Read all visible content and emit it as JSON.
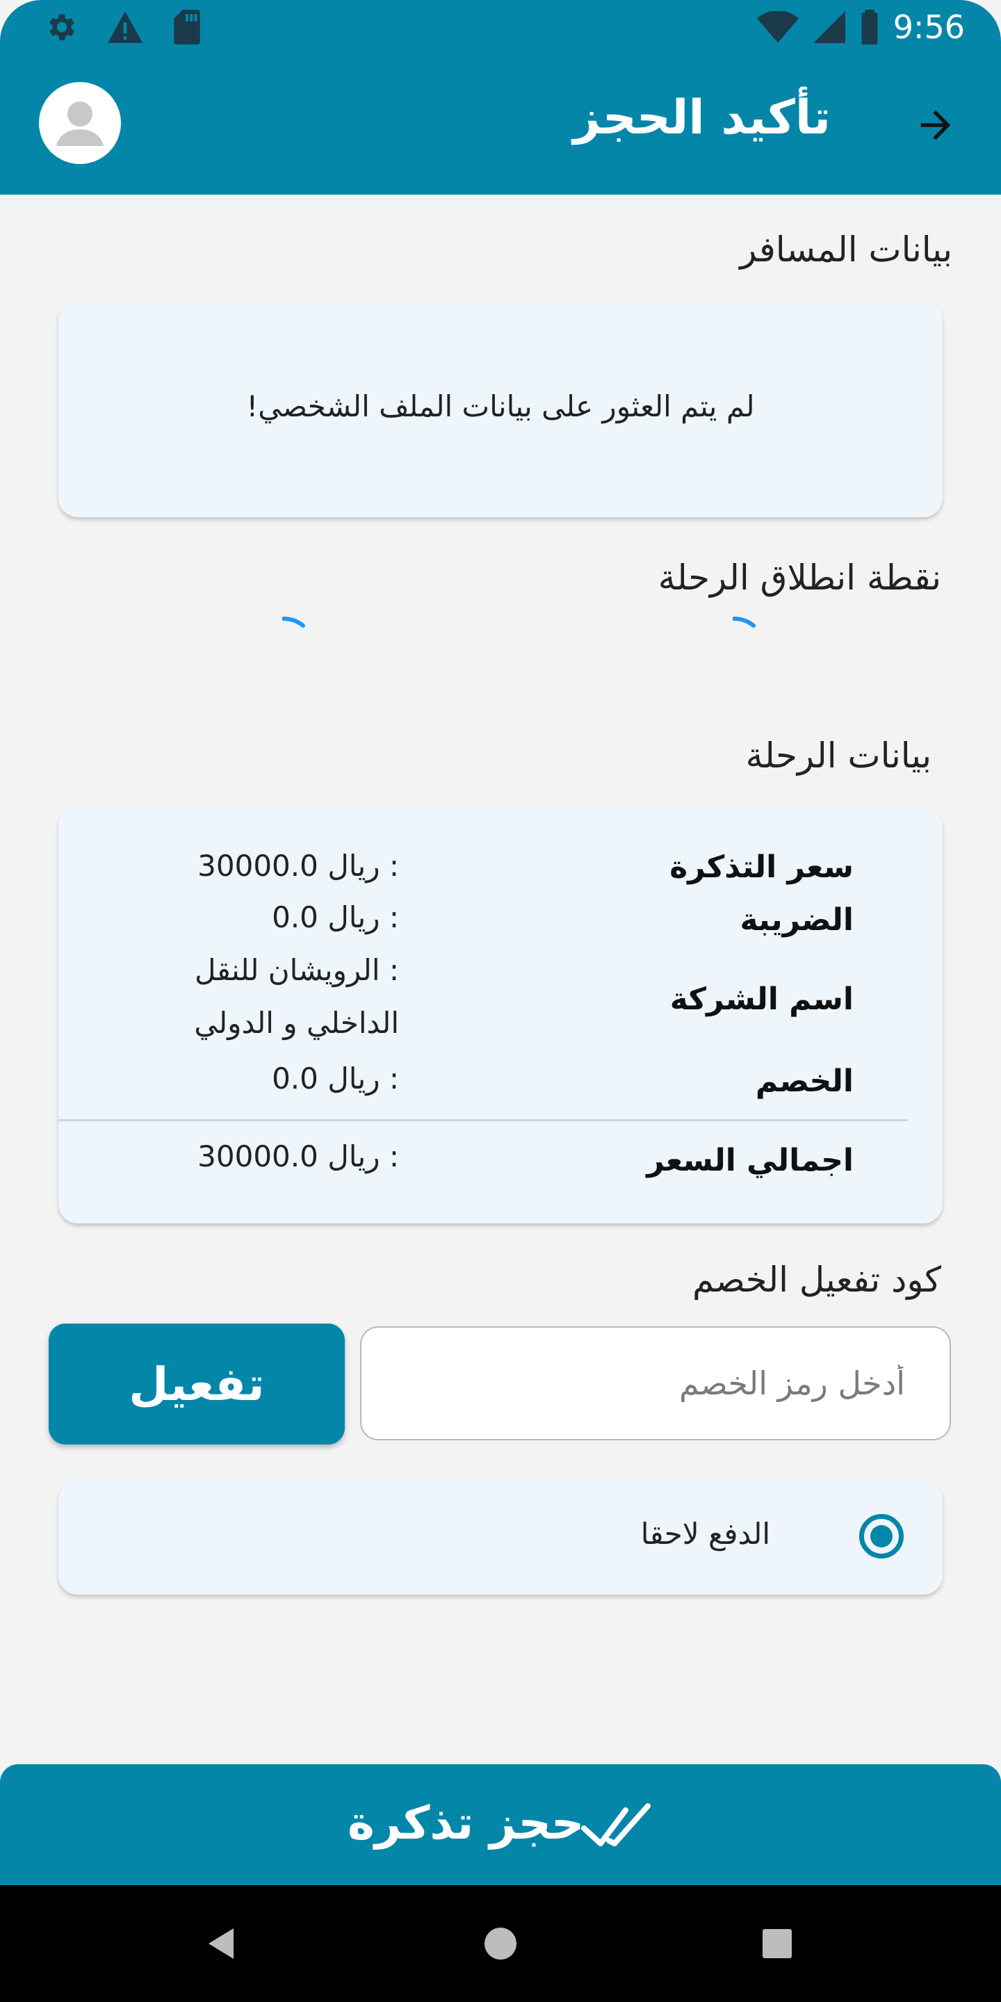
{
  "status_bar": {
    "time": "9:56"
  },
  "app_bar": {
    "title": "تأكيد الحجز"
  },
  "passenger": {
    "section_title": "بيانات المسافر",
    "empty_message": "لم يتم العثور على بيانات الملف الشخصي!"
  },
  "departure": {
    "section_title": "نقطة انطلاق الرحلة"
  },
  "trip": {
    "section_title": "بيانات الرحلة",
    "rows": [
      {
        "label": "سعر التذكرة",
        "value": ": ريال 30000.0"
      },
      {
        "label": "الضريبة",
        "value": ": ريال 0.0"
      },
      {
        "label": "اسم الشركة",
        "value": ": الرويشان للنقل الداخلي و الدولي"
      },
      {
        "label": "الخصم",
        "value": ": ريال 0.0"
      }
    ],
    "total": {
      "label": "اجمالي السعر",
      "value": ": ريال 30000.0"
    }
  },
  "promo": {
    "section_title": "كود تفعيل الخصم",
    "placeholder": "أدخل رمز الخصم",
    "button_label": "تفعيل"
  },
  "payment": {
    "option_label": "الدفع لاحقا",
    "selected": true
  },
  "book_button": {
    "label": "حجز تذكرة"
  },
  "colors": {
    "primary": "#0486a9",
    "card": "#eef5fb",
    "background": "#f3f3f3"
  }
}
